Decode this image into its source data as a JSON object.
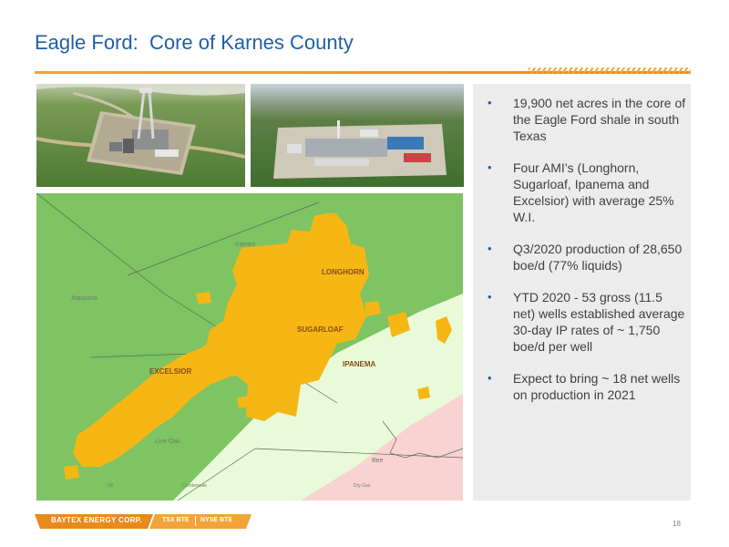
{
  "header": {
    "title": "Eagle Ford:  Core of Karnes County"
  },
  "map": {
    "county_labels": {
      "karnes": "Karnes",
      "atascosa": "Atascosa",
      "live_oak": "Live Oak",
      "bee": "Bee"
    },
    "area_labels": {
      "longhorn": "LONGHORN",
      "sugarloaf": "SUGARLOAF",
      "ipanema": "IPANEMA",
      "excelsior": "EXCELSIOR"
    },
    "legend": {
      "oil": "Oil",
      "condensate": "Condensate",
      "dry_gas": "Dry Gas"
    },
    "colors": {
      "oil_window": "#7ec462",
      "condensate_window": "#e8fad8",
      "gas_window": "#f9d2d2",
      "acreage": "#f6b614",
      "acreage_label": "#8a4c1a"
    }
  },
  "bullets": [
    "19,900 net acres in the core of the Eagle Ford shale in south Texas",
    "Four AMI’s (Longhorn, Sugarloaf, Ipanema and Excelsior) with average 25% W.I.",
    "Q3/2020 production of 28,650 boe/d (77% liquids)",
    "YTD 2020 - 53 gross (11.5 net) wells established average 30-day IP rates of ~ 1,750 boe/d per well",
    "Expect to bring ~ 18 net wells on production in 2021"
  ],
  "bullet_marker": "•",
  "footer": {
    "company": "BAYTEX ENERGY CORP.",
    "tsx": "TSX BTE",
    "nyse": "NYSE BTE"
  },
  "page_number": "18",
  "colors": {
    "title": "#1f5fa8",
    "accent": "#f2a33a",
    "panel": "#ececec",
    "footer_bar": "#e98a1e"
  }
}
